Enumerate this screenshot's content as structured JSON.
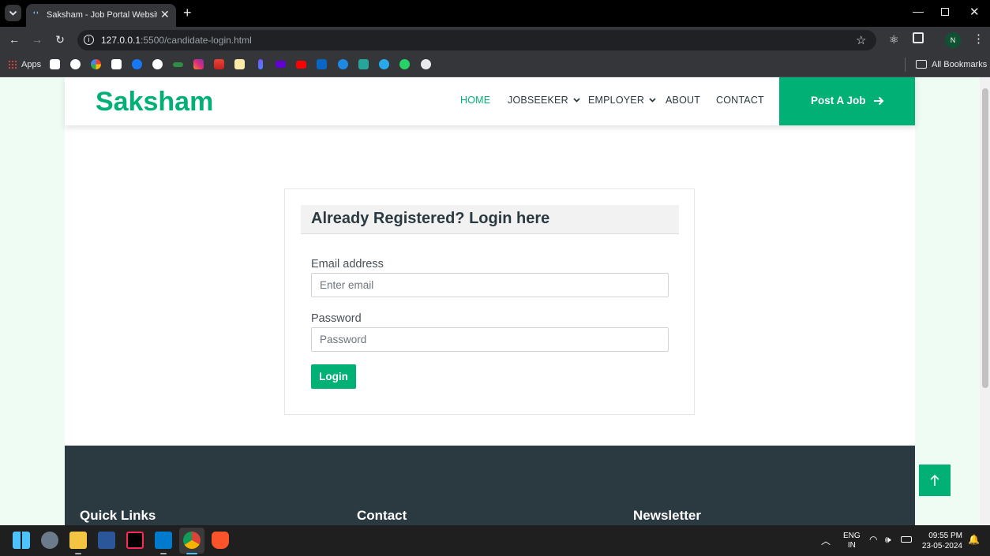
{
  "browser": {
    "tab_title": "Saksham - Job Portal Website T",
    "tab_favicon": "page-favicon",
    "new_tab": "+",
    "address": {
      "host": "127.0.0.1",
      "path": ":5500/candidate-login.html"
    },
    "profile_initial": "N",
    "bookmarks": {
      "apps_label": "Apps",
      "all_bookmarks_label": "All Bookmarks",
      "icons": [
        "amazon-icon",
        "chatgpt-icon",
        "google-icon",
        "dev-icon",
        "facebook-icon",
        "github-icon",
        "geeksforgeeks-icon",
        "instagram-icon",
        "gmail-icon",
        "keep-icon",
        "pen-icon",
        "yahoo-icon",
        "youtube-icon",
        "linkedin-icon",
        "play-icon",
        "image-icon",
        "telegram-icon",
        "whatsapp-icon",
        "globe-icon"
      ]
    }
  },
  "site": {
    "brand": "Saksham",
    "nav": {
      "home": "HOME",
      "jobseeker": "JOBSEEKER",
      "employer": "EMPLOYER",
      "about": "ABOUT",
      "contact": "CONTACT"
    },
    "post_job_label": "Post A Job",
    "login_card": {
      "title": "Already Registered? Login here",
      "email_label": "Email address",
      "email_placeholder": "Enter email",
      "email_value": "",
      "password_label": "Password",
      "password_placeholder": "Password",
      "password_value": "",
      "login_button": "Login"
    },
    "footer": {
      "quick_links": "Quick Links",
      "contact": "Contact",
      "newsletter": "Newsletter"
    }
  },
  "taskbar": {
    "lang_line1": "ENG",
    "lang_line2": "IN",
    "time": "09:55 PM",
    "date": "23-05-2024"
  },
  "colors": {
    "accent": "#00b074",
    "dark": "#2b3940",
    "page_bg": "#eefcf3"
  }
}
